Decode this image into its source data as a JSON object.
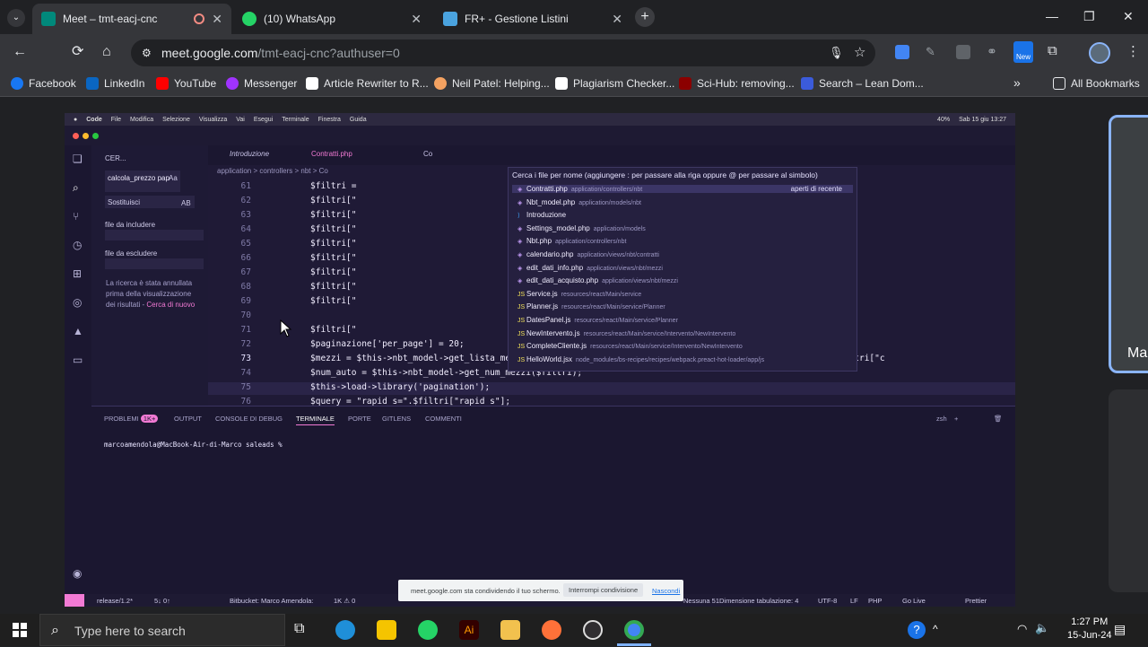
{
  "chrome": {
    "tabs": [
      {
        "title": "Meet – tmt-eacj-cnc",
        "active": true,
        "color": "#00897b"
      },
      {
        "title": "(10) WhatsApp",
        "active": false,
        "color": "#25d366"
      },
      {
        "title": "FR+ - Gestione Listini",
        "active": false,
        "color": "#4aa3df"
      }
    ],
    "url_host": "meet.google.com",
    "url_path": "/tmt-eacj-cnc?authuser=0",
    "new_badge": "New",
    "bookmarks": [
      {
        "label": "Facebook",
        "color": "#1877f2"
      },
      {
        "label": "LinkedIn",
        "color": "#0a66c2"
      },
      {
        "label": "YouTube",
        "color": "#ff0000"
      },
      {
        "label": "Messenger",
        "color": "#a033ff"
      },
      {
        "label": "Article Rewriter to R...",
        "color": "#ffffff"
      },
      {
        "label": "Neil Patel: Helping...",
        "color": "#f4a261"
      },
      {
        "label": "Plagiarism Checker...",
        "color": "#ffffff"
      },
      {
        "label": "Sci-Hub: removing...",
        "color": "#8b0000"
      },
      {
        "label": "Search – Lean Dom...",
        "color": "#3b5bdb"
      }
    ],
    "all_bookmarks": "All Bookmarks"
  },
  "mac": {
    "menubar": [
      "Code",
      "File",
      "Modifica",
      "Selezione",
      "Visualizza",
      "Vai",
      "Esegui",
      "Terminale",
      "Finestra",
      "Guida"
    ],
    "battery": "40%",
    "datetime": "Sab 15 giu 13:27"
  },
  "vscode": {
    "sidebar": {
      "header": "CER...",
      "search_value": "calcola_prezzo pap",
      "match_case": "Aa",
      "replace_value": "Sostituisci",
      "replace_opt": "AB",
      "include_label": "file da includere",
      "exclude_label": "file da escludere",
      "message": "La ricerca è stata annullata prima della visualizzazione dei risultati -",
      "retry_link": "Cerca di nuovo"
    },
    "tabs": [
      "Introduzione",
      "Contratti.php",
      "Co"
    ],
    "breadcrumb": "application > controllers > nbt > Co",
    "palette": {
      "placeholder": "Cerca i file per nome (aggiungere : per passare alla riga oppure @ per passare al simbolo)",
      "recent_label": "aperti di recente",
      "items": [
        {
          "name": "Contratti.php",
          "path": "application/controllers/nbt",
          "type": "php"
        },
        {
          "name": "Nbt_model.php",
          "path": "application/models/nbt",
          "type": "php"
        },
        {
          "name": "Introduzione",
          "path": "",
          "type": "vs"
        },
        {
          "name": "Settings_model.php",
          "path": "application/models",
          "type": "php"
        },
        {
          "name": "Nbt.php",
          "path": "application/controllers/nbt",
          "type": "php"
        },
        {
          "name": "calendario.php",
          "path": "application/views/nbt/contratti",
          "type": "php"
        },
        {
          "name": "edit_dati_info.php",
          "path": "application/views/nbt/mezzi",
          "type": "php"
        },
        {
          "name": "edit_dati_acquisto.php",
          "path": "application/views/nbt/mezzi",
          "type": "php"
        },
        {
          "name": "Service.js",
          "path": "resources/react/Main/service",
          "type": "js"
        },
        {
          "name": "Planner.js",
          "path": "resources/react/Main/service/Planner",
          "type": "js"
        },
        {
          "name": "DatesPanel.js",
          "path": "resources/react/Main/service/Planner",
          "type": "js"
        },
        {
          "name": "NewIntervento.js",
          "path": "resources/react/Main/service/Intervento/NewIntervento",
          "type": "js"
        },
        {
          "name": "CompleteCliente.js",
          "path": "resources/react/Main/service/Intervento/NewIntervento",
          "type": "js"
        },
        {
          "name": "HelloWorld.jsx",
          "path": "node_modules/bs-recipes/recipes/webpack.preact-hot-loader/app/js",
          "type": "js"
        }
      ]
    },
    "lines": [
      {
        "n": "61",
        "code": "$filtri ="
      },
      {
        "n": "62",
        "code": "$filtri[\""
      },
      {
        "n": "63",
        "code": "$filtri[\""
      },
      {
        "n": "64",
        "code": "$filtri[\""
      },
      {
        "n": "65",
        "code": "$filtri[\""
      },
      {
        "n": "66",
        "code": "$filtri[\""
      },
      {
        "n": "67",
        "code": "$filtri[\""
      },
      {
        "n": "68",
        "code": "$filtri[\""
      },
      {
        "n": "69",
        "code": "$filtri[\""
      },
      {
        "n": "70",
        "code": ""
      },
      {
        "n": "71",
        "code": "$filtri[\""
      },
      {
        "n": "72",
        "code": "$paginazione['per_page'] = 20;"
      },
      {
        "n": "73",
        "code": "$mezzi = $this->nbt_model->get_lista_mezzi($filtri[\"order\"],$filtri[\"dir\"], $paginazione['per_page'], $filtri[\"c"
      },
      {
        "n": "74",
        "code": "$num_auto = $this->nbt_model->get_num_mezzi($filtri);"
      },
      {
        "n": "75",
        "code": "$this->load->library('pagination');"
      },
      {
        "n": "76",
        "code": "$query = \"rapid_s=\".$filtri[\"rapid_s\"];"
      }
    ],
    "panel_tabs": [
      "PROBLEMI",
      "OUTPUT",
      "CONSOLE DI DEBUG",
      "TERMINALE",
      "PORTE",
      "GITLENS",
      "COMMENTI"
    ],
    "problems_badge": "1K+",
    "terminal_shell": "zsh",
    "prompt": "marcoamendola@MacBook-Air-di-Marco saleads %",
    "status": {
      "branch": "release/1.2*",
      "sync": "5↓ 0↑",
      "bitbucket": "Bitbucket: Marco Amendola:",
      "counts": "1K ⚠ 0",
      "selection": "Nessuna 51",
      "tab": "Dimensione tabulazione: 4",
      "encoding": "UTF-8",
      "eol": "LF",
      "lang": "PHP",
      "golive": "Go Live",
      "prettier": "Prettier"
    }
  },
  "share_notice": {
    "message": "meet.google.com sta condividendo il tuo schermo.",
    "stop": "Interrompi condivisione",
    "hide": "Nascondi"
  },
  "participant_name": "Ma",
  "taskbar": {
    "search_placeholder": "Type here to search",
    "time": "1:27 PM",
    "date": "15-Jun-24"
  }
}
